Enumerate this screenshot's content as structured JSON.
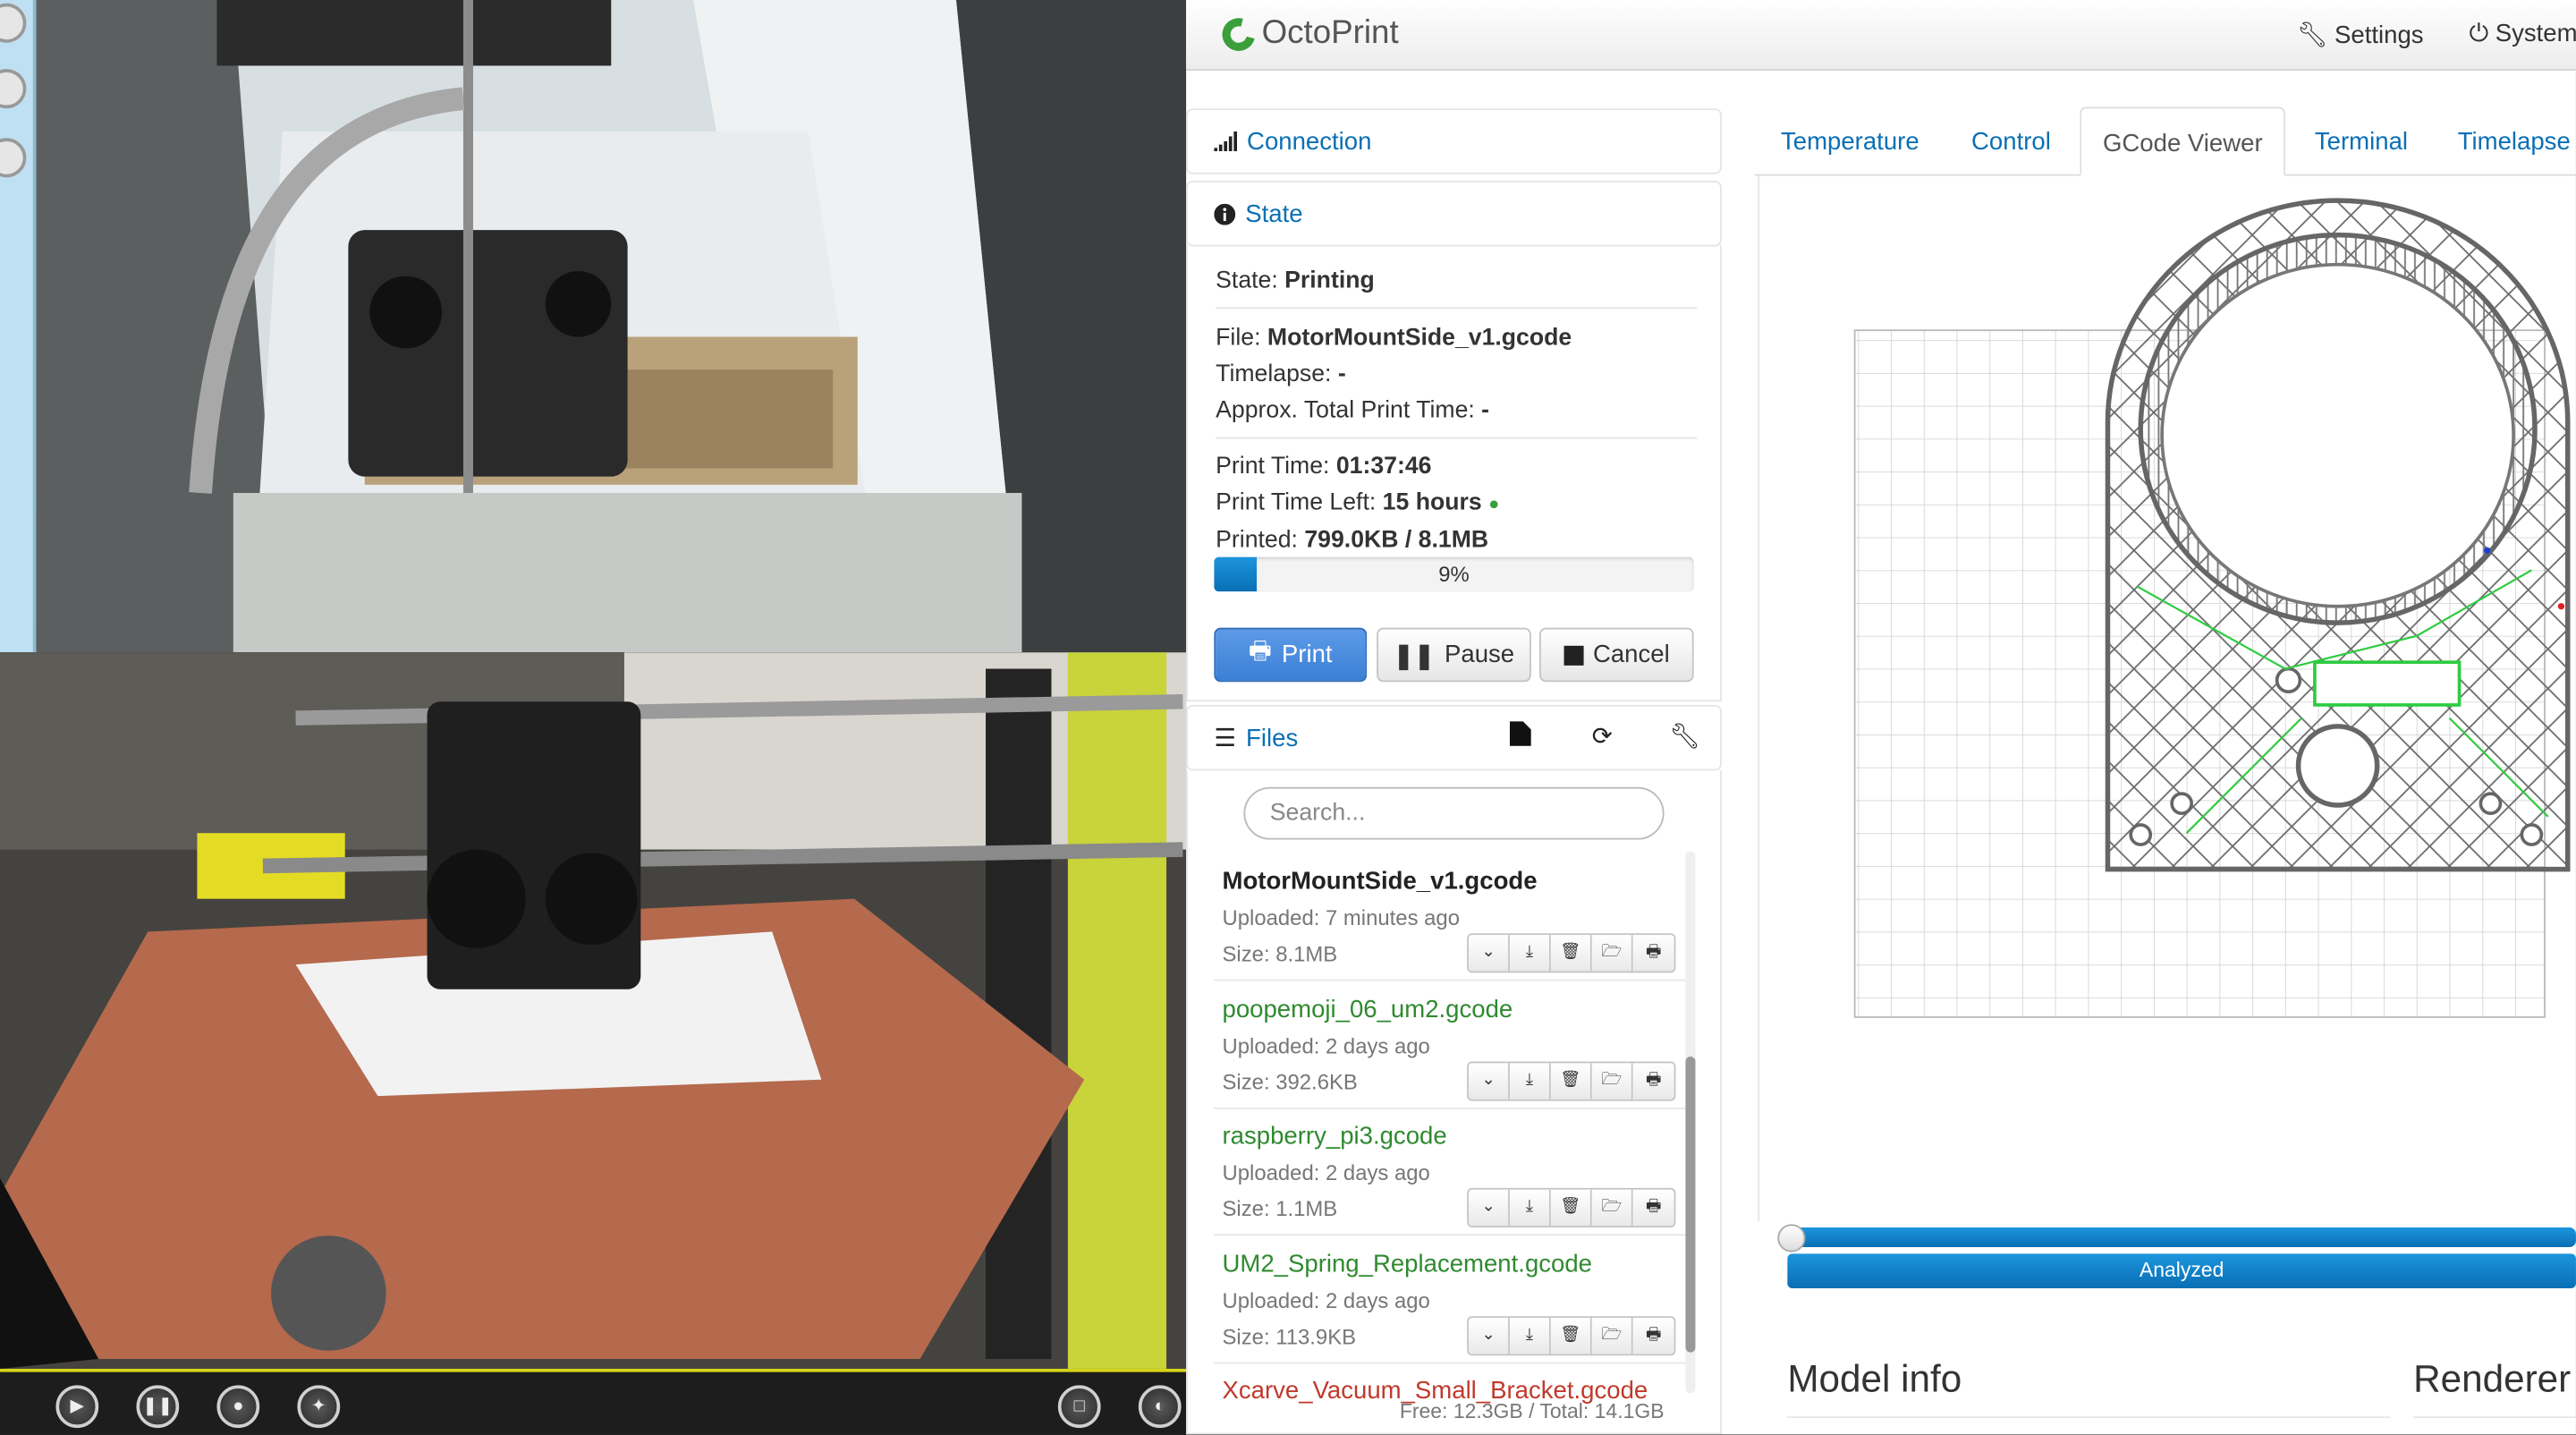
{
  "brand": {
    "name": "OctoPrint"
  },
  "navbar": {
    "settings": "Settings",
    "system": "System"
  },
  "sidebar": {
    "connection": "Connection",
    "state": {
      "title": "State",
      "state_label": "State:",
      "state_value": "Printing",
      "file_label": "File:",
      "file_value": "MotorMountSide_v1.gcode",
      "timelapse_label": "Timelapse:",
      "timelapse_value": "-",
      "approx_label": "Approx. Total Print Time:",
      "approx_value": "-",
      "print_time_label": "Print Time:",
      "print_time_value": "01:37:46",
      "time_left_label": "Print Time Left:",
      "time_left_value": "15 hours",
      "printed_label": "Printed:",
      "printed_value": "799.0KB / 8.1MB",
      "progress_percent": 9,
      "progress_text": "9%"
    },
    "buttons": {
      "print": "Print",
      "pause": "Pause",
      "cancel": "Cancel"
    },
    "files": {
      "title": "Files",
      "search_placeholder": "Search...",
      "items": [
        {
          "name": "MotorMountSide_v1.gcode",
          "uploaded": "Uploaded: 7 minutes ago",
          "size": "Size: 8.1MB",
          "color": "#222222"
        },
        {
          "name": "poopemoji_06_um2.gcode",
          "uploaded": "Uploaded: 2 days ago",
          "size": "Size: 392.6KB",
          "color": "#2f8a2f"
        },
        {
          "name": "raspberry_pi3.gcode",
          "uploaded": "Uploaded: 2 days ago",
          "size": "Size: 1.1MB",
          "color": "#2f8a2f"
        },
        {
          "name": "UM2_Spring_Replacement.gcode",
          "uploaded": "Uploaded: 2 days ago",
          "size": "Size: 113.9KB",
          "color": "#2f8a2f"
        },
        {
          "name": "Xcarve_Vacuum_Small_Bracket.gcode",
          "uploaded": "",
          "size": "",
          "color": "#c0392b"
        }
      ],
      "free": "Free: 12.3GB / Total: 14.1GB"
    }
  },
  "tabs": [
    "Temperature",
    "Control",
    "GCode Viewer",
    "Terminal",
    "Timelapse"
  ],
  "active_tab": "GCode Viewer",
  "viewer": {
    "analyzed": "Analyzed"
  },
  "sections": {
    "model_info": "Model info",
    "renderer": "Renderer"
  },
  "colors": {
    "accent": "#0a6fb4",
    "primary_button": "#3b7fd4",
    "success": "#3a9f3a",
    "danger": "#c0392b"
  }
}
